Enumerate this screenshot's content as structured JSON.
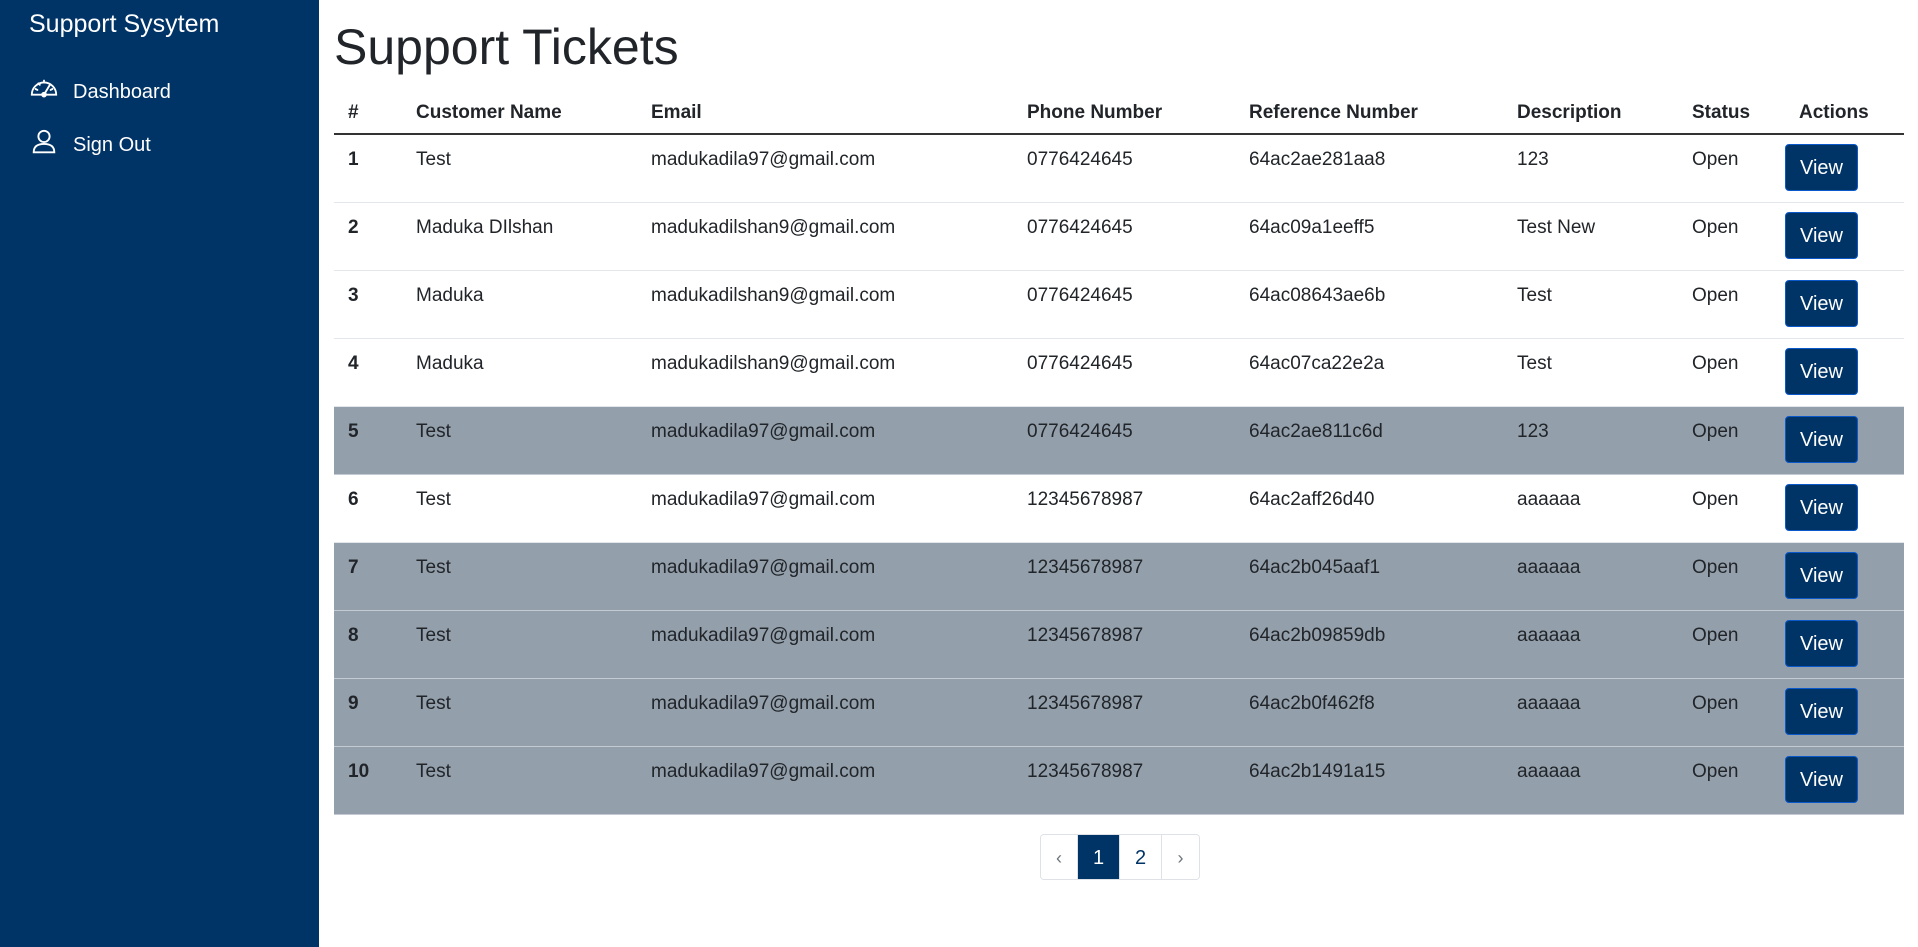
{
  "sidebar": {
    "brand": "Support Sysytem",
    "items": [
      {
        "label": "Dashboard",
        "icon": "speedometer-icon"
      },
      {
        "label": "Sign Out",
        "icon": "person-icon"
      }
    ]
  },
  "main": {
    "title": "Support Tickets",
    "columns": [
      "#",
      "Customer Name",
      "Email",
      "Phone Number",
      "Reference Number",
      "Description",
      "Status",
      "Actions"
    ],
    "view_label": "View",
    "rows": [
      {
        "num": "1",
        "name": "Test",
        "email": "madukadila97@gmail.com",
        "phone": "0776424645",
        "ref": "64ac2ae281aa8",
        "desc": "123",
        "status": "Open"
      },
      {
        "num": "2",
        "name": "Maduka DIlshan",
        "email": "madukadilshan9@gmail.com",
        "phone": "0776424645",
        "ref": "64ac09a1eeff5",
        "desc": "Test New",
        "status": "Open"
      },
      {
        "num": "3",
        "name": "Maduka",
        "email": "madukadilshan9@gmail.com",
        "phone": "0776424645",
        "ref": "64ac08643ae6b",
        "desc": "Test",
        "status": "Open"
      },
      {
        "num": "4",
        "name": "Maduka",
        "email": "madukadilshan9@gmail.com",
        "phone": "0776424645",
        "ref": "64ac07ca22e2a",
        "desc": "Test",
        "status": "Open"
      },
      {
        "num": "5",
        "name": "Test",
        "email": "madukadila97@gmail.com",
        "phone": "0776424645",
        "ref": "64ac2ae811c6d",
        "desc": "123",
        "status": "Open"
      },
      {
        "num": "6",
        "name": "Test",
        "email": "madukadila97@gmail.com",
        "phone": "12345678987",
        "ref": "64ac2aff26d40",
        "desc": "aaaaaa",
        "status": "Open"
      },
      {
        "num": "7",
        "name": "Test",
        "email": "madukadila97@gmail.com",
        "phone": "12345678987",
        "ref": "64ac2b045aaf1",
        "desc": "aaaaaa",
        "status": "Open"
      },
      {
        "num": "8",
        "name": "Test",
        "email": "madukadila97@gmail.com",
        "phone": "12345678987",
        "ref": "64ac2b09859db",
        "desc": "aaaaaa",
        "status": "Open"
      },
      {
        "num": "9",
        "name": "Test",
        "email": "madukadila97@gmail.com",
        "phone": "12345678987",
        "ref": "64ac2b0f462f8",
        "desc": "aaaaaa",
        "status": "Open"
      },
      {
        "num": "10",
        "name": "Test",
        "email": "madukadila97@gmail.com",
        "phone": "12345678987",
        "ref": "64ac2b1491a15",
        "desc": "aaaaaa",
        "status": "Open"
      }
    ]
  },
  "pagination": {
    "prev": "‹",
    "pages": [
      "1",
      "2"
    ],
    "next": "›",
    "current": "1"
  },
  "colors": {
    "sidebar": "#003366",
    "accent": "#003366",
    "highlight_row": "#939fab"
  }
}
